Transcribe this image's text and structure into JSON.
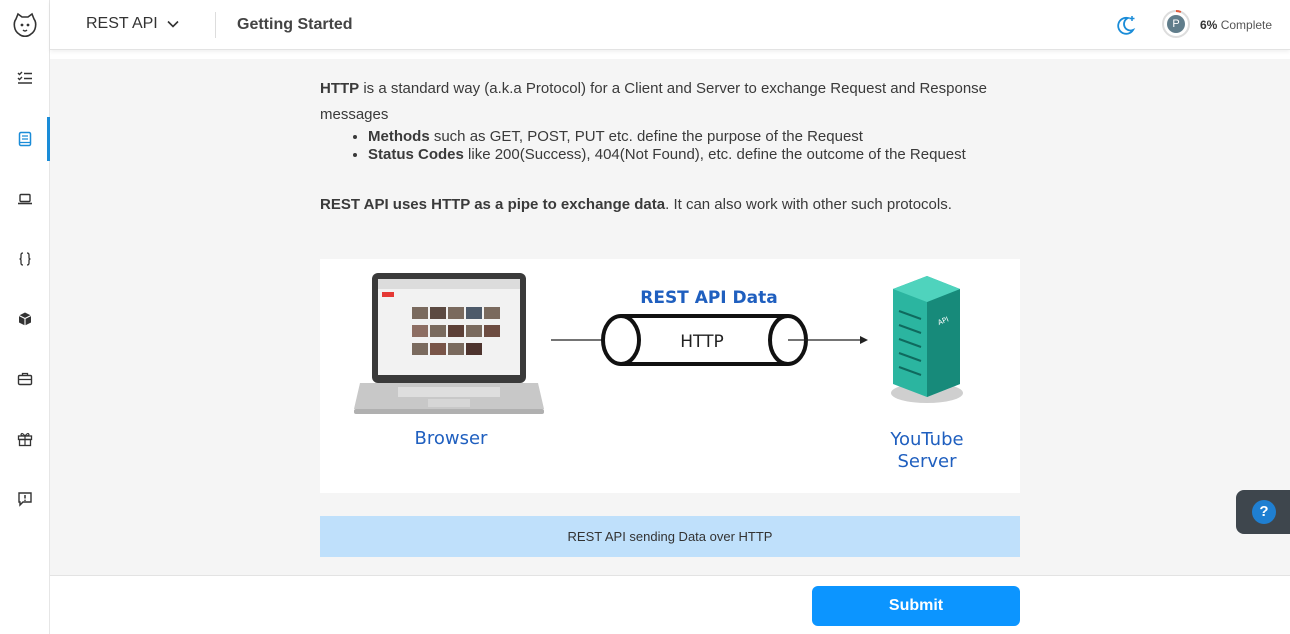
{
  "header": {
    "course_title": "REST API",
    "page_title": "Getting Started",
    "progress_percent": "6%",
    "progress_label": "Complete",
    "avatar_initial": "P"
  },
  "sidebar": {
    "items": [
      {
        "icon": "checklist-icon",
        "active": false
      },
      {
        "icon": "book-icon",
        "active": true
      },
      {
        "icon": "laptop-icon",
        "active": false
      },
      {
        "icon": "braces-icon",
        "active": false
      },
      {
        "icon": "cube-icon",
        "active": false
      },
      {
        "icon": "briefcase-icon",
        "active": false
      },
      {
        "icon": "gift-icon",
        "active": false
      },
      {
        "icon": "feedback-icon",
        "active": false
      }
    ]
  },
  "content": {
    "intro_bold": "HTTP",
    "intro_text": " is a standard way (a.k.a Protocol) for a Client and Server to exchange Request and Response messages",
    "bullets": [
      {
        "bold": "Methods",
        "text": " such as GET, POST, PUT etc. define the purpose of the Request"
      },
      {
        "bold": "Status Codes",
        "text": " like 200(Success), 404(Not Found), etc. define the outcome of the Request"
      }
    ],
    "p2_bold": "REST API uses HTTP as a pipe to exchange data",
    "p2_text": ". It can also work with other such protocols."
  },
  "diagram": {
    "pipe_title": "REST API Data",
    "pipe_label": "HTTP",
    "client_label": "Browser",
    "server_label_1": "YouTube",
    "server_label_2": "Server",
    "server_tag": "API",
    "accent_blue": "#1f5fbf"
  },
  "caption": "REST API sending Data over HTTP",
  "help_label": "?",
  "footer": {
    "submit_label": "Submit"
  },
  "colors": {
    "primary": "#0c95ff",
    "active_indicator": "#1a8cd8",
    "caption_bg": "#bfe0fb"
  }
}
